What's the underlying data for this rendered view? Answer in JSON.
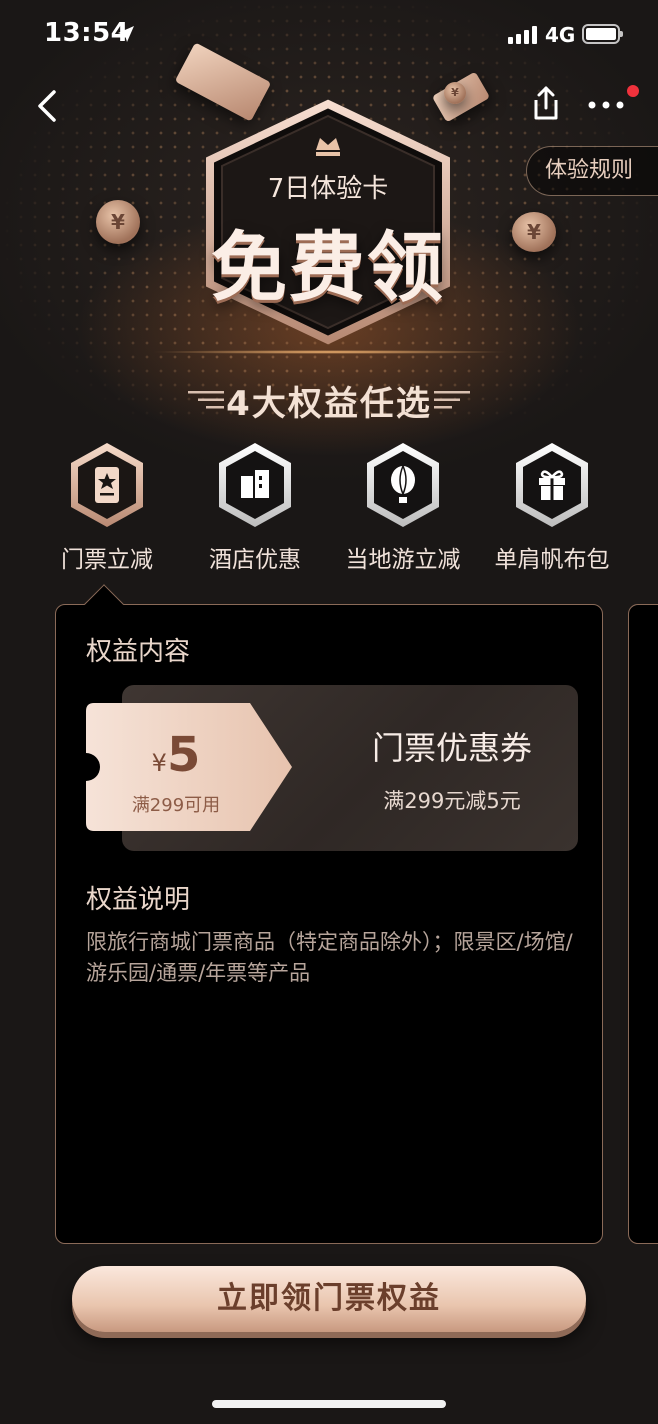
{
  "status_bar": {
    "time": "13:54",
    "network": "4G"
  },
  "nav": {
    "rules_label": "体验规则"
  },
  "hero": {
    "badge_subtitle": "7日体验卡",
    "badge_title": "免费领",
    "section_heading": "4大权益任选"
  },
  "benefits": [
    {
      "label": "门票立减",
      "icon": "ticket-icon",
      "selected": true
    },
    {
      "label": "酒店优惠",
      "icon": "hotel-icon",
      "selected": false
    },
    {
      "label": "当地游立减",
      "icon": "balloon-icon",
      "selected": false
    },
    {
      "label": "单肩帆布包",
      "icon": "gift-icon",
      "selected": false
    }
  ],
  "panel": {
    "content_title": "权益内容",
    "coupon": {
      "currency": "¥",
      "amount": "5",
      "condition": "满299可用",
      "title": "门票优惠券",
      "subtitle": "满299元减5元"
    },
    "desc_title": "权益说明",
    "desc_text": "限旅行商城门票商品（特定商品除外）；限景区/场馆/游乐园/通票/年票等产品"
  },
  "cta": {
    "label": "立即领门票权益"
  },
  "colors": {
    "background": "#1a1716",
    "accent_gold": "#e9c5ae",
    "accent_brown": "#6b3f2c",
    "notification_red": "#f0323c"
  }
}
